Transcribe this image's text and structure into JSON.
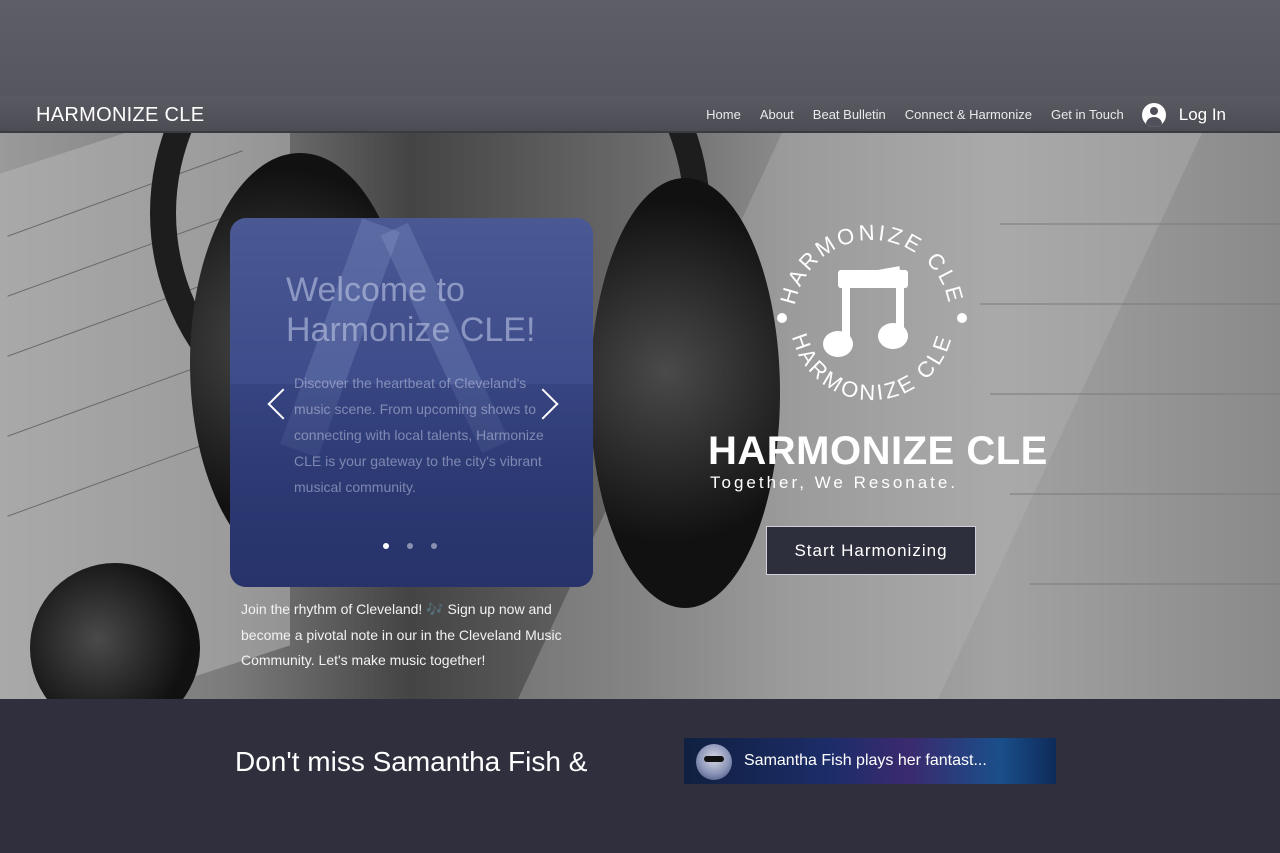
{
  "header": {
    "brand": "HARMONIZE CLE",
    "nav": [
      "Home",
      "About",
      "Beat Bulletin",
      "Connect & Harmonize",
      "Get in Touch"
    ],
    "login_label": "Log In",
    "login_icon": "user-avatar-icon"
  },
  "hero": {
    "slider": {
      "title": "Welcome to Harmonize CLE!",
      "text": "Discover the heartbeat of Cleveland's music scene. From upcoming shows to connecting with local talents, Harmonize CLE is your gateway to the city's vibrant musical community.",
      "dot_count": 3,
      "active_dot": 0
    },
    "join_text": "Join the rhythm of Cleveland! 🎶 Sign up now and become a pivotal note in our in the Cleveland Music Community. Let's make music together!",
    "logo": {
      "ring_text": "HARMONIZE CLE",
      "icon": "music-note-icon"
    },
    "big_name": "HARMONIZE CLE",
    "tagline": "Together, We Resonate.",
    "cta_label": "Start Harmonizing"
  },
  "bottom": {
    "promo_text": "Don't miss Samantha Fish &",
    "video_title": "Samantha Fish plays her fantast..."
  }
}
